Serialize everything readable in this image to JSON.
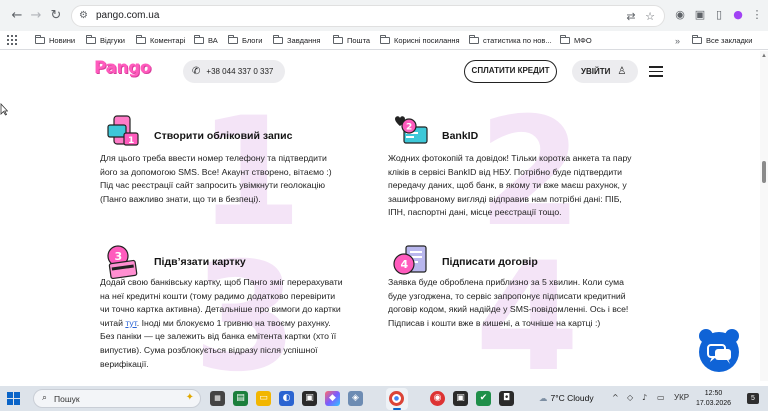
{
  "browser": {
    "url": "pango.com.ua",
    "bookmarks_label": "Все закладки",
    "bookmarks": [
      "Новини",
      "Відгуки",
      "Коментарі",
      "ВА",
      "Блоги",
      "Завдання",
      "Пошта",
      "Корисні посилання",
      "статистика по нов...",
      "МФО"
    ]
  },
  "header": {
    "logo": "Pango",
    "phone": "+38 044 337 0 337",
    "pay_label": "СПЛАТИТИ КРЕДИТ",
    "login_label": "УВІЙТИ"
  },
  "steps": [
    {
      "number": "1",
      "title": "Створити обліковий запис",
      "lines": [
        "Для цього треба ввести номер телефону та підтвердити",
        "його за допомогою SMS. Все! Акаунт створено, вітаємо :)",
        "Під час реєстрації сайт запросить увімкнути геолокацію",
        "(Панго важливо знати, що ти в безпеці)."
      ]
    },
    {
      "number": "2",
      "title": "BankID",
      "lines": [
        "Жодних фотокопій та довідок! Тільки коротка анкета та пару",
        "кліків в сервісі BankID від НБУ. Потрібно буде підтвердити",
        "передачу даних, щоб банк, в якому ти вже маєш рахунок, у",
        "зашифрованому вигляді відправив нам потрібні дані: ПІБ,",
        "ІПН, паспортні дані, місце реєстрації тощо."
      ]
    },
    {
      "number": "3",
      "title": "Підв’язати картку",
      "lines": [
        "Додай свою банківську картку, щоб Панго зміг перерахувати",
        "на неї кредитні кошти (тому радимо додатково перевірити",
        "чи точно картка активна). Детальніше про вимоги до картки"
      ],
      "link_prefix": "читай ",
      "link_text": "тут",
      "link_suffix": ". Іноді ми блокуємо 1 гривню на твоєму рахунку.",
      "lines_after": [
        "Без паніки — це залежить від банка емітента картки (хто її",
        "випустив). Сума розблокується відразу після успішної",
        "верифікації."
      ]
    },
    {
      "number": "4",
      "title": "Підписати договір",
      "lines": [
        "Заявка буде оброблена приблизно за 5 хвилин. Коли сума",
        "буде узгоджена, то сервіс запропонує підписати кредитний",
        "договір кодом, який надійде у SMS-повідомленні. Ось і все!",
        "Підписав і кошти вже в кишені, а точніше на картці :)"
      ]
    }
  ],
  "taskbar": {
    "search_placeholder": "Пошук",
    "weather": "7°C Cloudy",
    "language": "УКР",
    "time": "12:50",
    "date": "17.03.2026",
    "notifications": "5"
  },
  "colors": {
    "brand_pink": "#ff5bbd",
    "number_watermark": "#f4e4f7",
    "chat_blue": "#0f63d6"
  }
}
